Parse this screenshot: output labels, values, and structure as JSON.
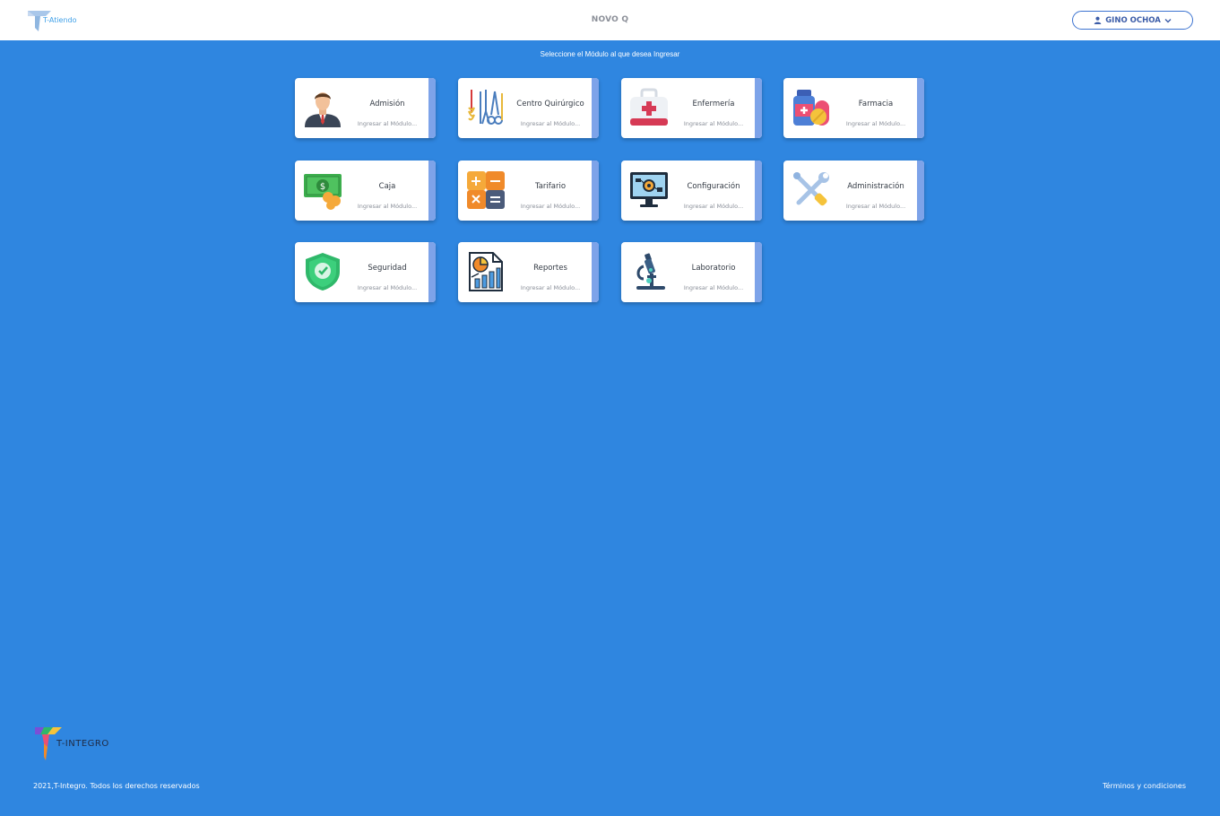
{
  "header": {
    "logo_text": "T-Atiendo",
    "title": "NOVO Q",
    "user_name": "GINO OCHOA"
  },
  "main": {
    "instruction": "Seleccione el Módulo al que desea Ingresar",
    "modules": [
      {
        "label": "Admisión",
        "sub": "Ingresar al Módulo...",
        "icon": "person-icon"
      },
      {
        "label": "Centro Quirúrgico",
        "sub": "Ingresar al Módulo...",
        "icon": "surgical-tools-icon"
      },
      {
        "label": "Enfermería",
        "sub": "Ingresar al Módulo...",
        "icon": "first-aid-kit-icon"
      },
      {
        "label": "Farmacia",
        "sub": "Ingresar al Módulo...",
        "icon": "medicine-icon"
      },
      {
        "label": "Caja",
        "sub": "Ingresar al Módulo...",
        "icon": "money-icon"
      },
      {
        "label": "Tarifario",
        "sub": "Ingresar al Módulo...",
        "icon": "calculator-icon"
      },
      {
        "label": "Configuración",
        "sub": "Ingresar al Módulo...",
        "icon": "computer-settings-icon"
      },
      {
        "label": "Administración",
        "sub": "Ingresar al Módulo...",
        "icon": "tools-icon"
      },
      {
        "label": "Seguridad",
        "sub": "Ingresar al Módulo...",
        "icon": "shield-icon"
      },
      {
        "label": "Reportes",
        "sub": "Ingresar al Módulo...",
        "icon": "report-icon"
      },
      {
        "label": "Laboratorio",
        "sub": "Ingresar al Módulo...",
        "icon": "microscope-icon"
      }
    ]
  },
  "footer": {
    "logo_text": "T-INTEGRO",
    "copyright": "2021,T-Integro. Todos los derechos reservados",
    "terms": "Términos y condiciones"
  },
  "colors": {
    "background": "#2f86e0",
    "card_strip": "#7da3e9",
    "user_button_border": "#3c73d0"
  }
}
